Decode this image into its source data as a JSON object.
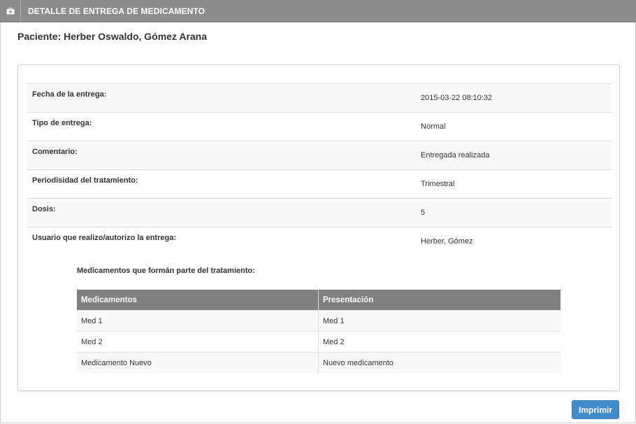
{
  "header": {
    "title": "DETALLE DE ENTREGA DE MEDICAMENTO",
    "icon": "medkit-icon"
  },
  "patient": {
    "heading": "Paciente: Herber Oswaldo, Gómez Arana"
  },
  "details": [
    {
      "label": "Fecha de la entrega:",
      "value": "2015-03-22 08:10:32"
    },
    {
      "label": "Tipo de entrega:",
      "value": "Normal"
    },
    {
      "label": "Comentario:",
      "value": "Entregada realizada"
    },
    {
      "label": "Periodisidad del tratamiento:",
      "value": "Trimestral"
    },
    {
      "label": "Dosis:",
      "value": "5"
    },
    {
      "label": "Usuario que realizo/autorizo la entrega:",
      "value": "Herber, Gómez"
    }
  ],
  "medications": {
    "title": "Medicamentos que formán parte del tratamiento:",
    "columns": [
      "Medicamentos",
      "Presentación"
    ],
    "rows": [
      [
        "Med 1",
        "Med 1"
      ],
      [
        "Med 2",
        "Med 2"
      ],
      [
        "Medicamento Nuevo",
        "Nuevo medicamento"
      ]
    ]
  },
  "actions": {
    "print_label": "Imprimir"
  },
  "colors": {
    "header_bg": "#8c8c8c",
    "table_header_bg": "#808080",
    "button_primary": "#428bca"
  }
}
